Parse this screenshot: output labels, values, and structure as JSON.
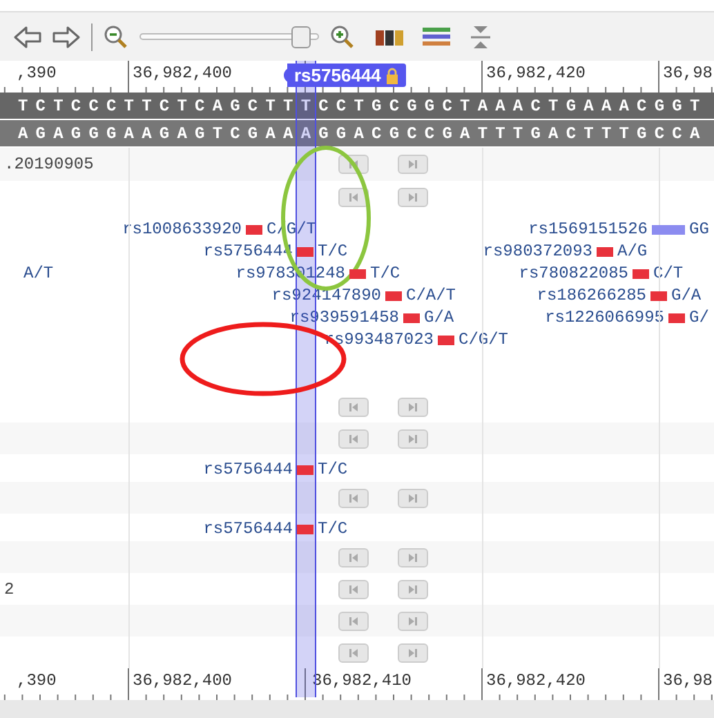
{
  "toolbar": {
    "zoom": {
      "level": 0.9
    }
  },
  "ruler_top": {
    "labels": [
      ",390",
      "36,982,400",
      "36,982,420",
      "36,98"
    ]
  },
  "selected_feature": {
    "label": "rs5756444",
    "locked": true
  },
  "sequence": {
    "forward": "TCTCCCTTCTCAGCTTTCCTGCGGCTAAACTGAAACGGT",
    "reverse": "AGAGGGAAGAGTCGAAAGGACGCCGATTTGACTTTGCCA"
  },
  "tracks": [
    {
      "kind": "nav",
      "label": ".20190905"
    },
    {
      "kind": "nav"
    },
    {
      "kind": "snps",
      "lines": [
        [
          {
            "id": "rs1008633920",
            "alleles": "C/G/T",
            "color": "#e8323c"
          },
          {
            "id": "rs1569151526",
            "alleles": "GG",
            "color": "#8c8cf0"
          }
        ],
        [
          {
            "id": "rs5756444",
            "alleles": "T/C",
            "color": "#e8323c"
          },
          {
            "id": "rs980372093",
            "alleles": "A/G",
            "color": "#e8323c"
          }
        ],
        [
          {
            "alleles": "A/T"
          },
          {
            "id": "rs978301248",
            "alleles": "T/C",
            "color": "#e8323c"
          },
          {
            "id": "rs780822085",
            "alleles": "C/T",
            "color": "#e8323c"
          }
        ],
        [
          {
            "id": "rs924147890",
            "alleles": "C/A/T",
            "color": "#e8323c"
          },
          {
            "id": "rs186266285",
            "alleles": "G/A",
            "color": "#e8323c"
          }
        ],
        [
          {
            "id": "rs939591458",
            "alleles": "G/A",
            "color": "#e8323c"
          },
          {
            "id": "rs1226066995",
            "alleles": "G/",
            "color": "#e8323c"
          }
        ],
        [
          {
            "id": "rs993487023",
            "alleles": "C/G/T",
            "color": "#e8323c"
          }
        ]
      ]
    },
    {
      "kind": "nav"
    },
    {
      "kind": "nav"
    },
    {
      "kind": "snps",
      "lines": [
        [
          {
            "id": "rs5756444",
            "alleles": "T/C",
            "color": "#e8323c"
          }
        ]
      ]
    },
    {
      "kind": "nav"
    },
    {
      "kind": "snps",
      "lines": [
        [
          {
            "id": "rs5756444",
            "alleles": "T/C",
            "color": "#e8323c"
          }
        ]
      ]
    },
    {
      "kind": "nav"
    },
    {
      "kind": "nav",
      "label": "2"
    },
    {
      "kind": "nav"
    },
    {
      "kind": "nav"
    }
  ],
  "ruler_bottom": {
    "labels": [
      ",390",
      "36,982,400",
      "36,982,410",
      "36,982,420",
      "36,98"
    ]
  }
}
